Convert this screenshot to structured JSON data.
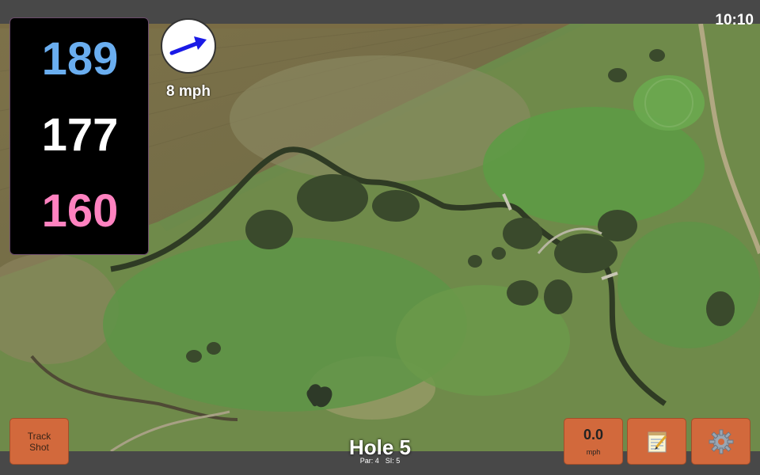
{
  "status": {
    "time": "10:10"
  },
  "distances": {
    "back": "189",
    "middle": "177",
    "front": "160",
    "colors": {
      "back": "#6aaef0",
      "middle": "#ffffff",
      "front": "#ff82c0"
    }
  },
  "wind": {
    "speed_label": "8 mph",
    "arrow_color": "#1a1ae6",
    "icon": "arrow-icon"
  },
  "track_button": {
    "line1": "Track",
    "line2": "Shot"
  },
  "hole": {
    "title": "Hole 5",
    "par": "Par: 4",
    "stroke_index": "SI: 5"
  },
  "speed": {
    "value": "0.0",
    "unit": "mph"
  },
  "icons": {
    "notes": "notepad-icon",
    "settings": "gear-icon"
  },
  "colors": {
    "button": "#d2693c",
    "bar": "#484848"
  }
}
